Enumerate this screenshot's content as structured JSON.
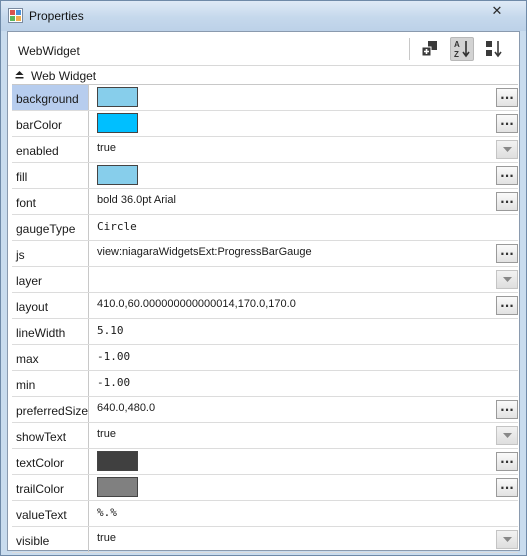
{
  "window": {
    "title": "Properties",
    "close_glyph": "✕"
  },
  "toolbar": {
    "object_title": "WebWidget"
  },
  "group": {
    "label": "Web Widget"
  },
  "icons": {
    "app": "properties-window-icon",
    "add_slot": "add-slot-icon",
    "sort_az": "sort-alphabetical-icon",
    "sort_order": "sort-order-icon",
    "collapse": "collapse-up-icon",
    "ellipsis": "ellipsis-icon",
    "dropdown": "dropdown-arrow-icon"
  },
  "ellipsis_label": "...",
  "properties": [
    {
      "name": "background",
      "kind": "color",
      "value": "#87ceeb",
      "editor": "ellipsis",
      "selected": true
    },
    {
      "name": "barColor",
      "kind": "color",
      "value": "#00bfff",
      "editor": "ellipsis"
    },
    {
      "name": "enabled",
      "kind": "text",
      "value": "true",
      "editor": "dropdown"
    },
    {
      "name": "fill",
      "kind": "color",
      "value": "#87ceeb",
      "editor": "ellipsis"
    },
    {
      "name": "font",
      "kind": "text",
      "value": "bold 36.0pt Arial",
      "editor": "ellipsis"
    },
    {
      "name": "gaugeType",
      "kind": "mono",
      "value": "Circle",
      "editor": "none"
    },
    {
      "name": "js",
      "kind": "text",
      "value": "view:niagaraWidgetsExt:ProgressBarGauge",
      "editor": "ellipsis"
    },
    {
      "name": "layer",
      "kind": "text",
      "value": "",
      "editor": "dropdown"
    },
    {
      "name": "layout",
      "kind": "text",
      "value": "410.0,60.000000000000014,170.0,170.0",
      "editor": "ellipsis"
    },
    {
      "name": "lineWidth",
      "kind": "mono",
      "value": "5.10",
      "editor": "none"
    },
    {
      "name": "max",
      "kind": "mono",
      "value": "-1.00",
      "editor": "none"
    },
    {
      "name": "min",
      "kind": "mono",
      "value": "-1.00",
      "editor": "none"
    },
    {
      "name": "preferredSize",
      "kind": "text",
      "value": "640.0,480.0",
      "editor": "ellipsis"
    },
    {
      "name": "showText",
      "kind": "text",
      "value": "true",
      "editor": "dropdown"
    },
    {
      "name": "textColor",
      "kind": "color",
      "value": "#404040",
      "editor": "ellipsis"
    },
    {
      "name": "trailColor",
      "kind": "color",
      "value": "#808080",
      "editor": "ellipsis"
    },
    {
      "name": "valueText",
      "kind": "mono",
      "value": "%.%",
      "editor": "none"
    },
    {
      "name": "visible",
      "kind": "text",
      "value": "true",
      "editor": "dropdown"
    }
  ]
}
